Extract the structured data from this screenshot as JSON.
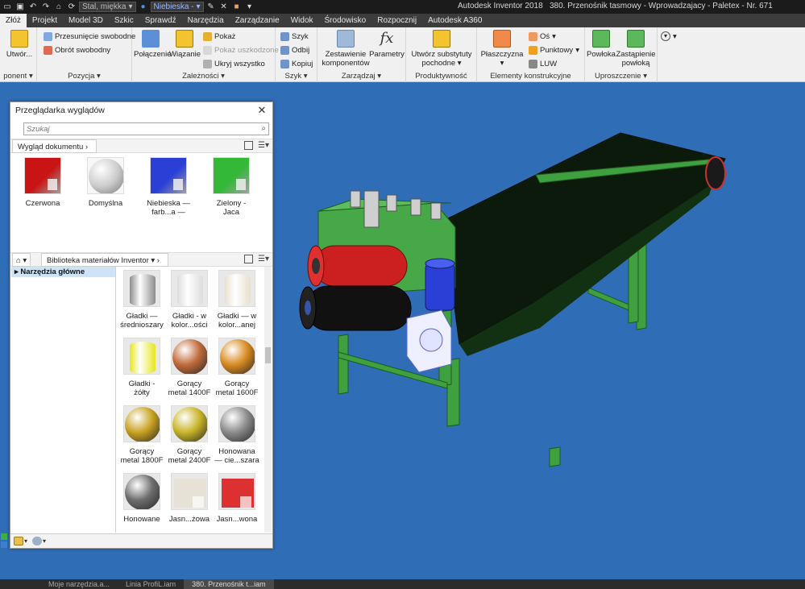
{
  "title_bar": {
    "material_dropdown": "Stal, miękka",
    "appearance_dropdown": "Niebieska -",
    "app_name": "Autodesk Inventor 2018",
    "document_title": "380. Przenośnik tasmowy - Wprowadzajacy - Paletex - Nr. 671"
  },
  "tabs": [
    "Złóż",
    "Projekt",
    "Model 3D",
    "Szkic",
    "Sprawdź",
    "Narzędzia",
    "Zarządzanie",
    "Widok",
    "Środowisko",
    "Rozpocznij",
    "Autodesk A360"
  ],
  "ribbon": {
    "panels": {
      "component": "ponent",
      "position": "Pozycja",
      "relations": "Zależności",
      "pattern": "Szyk",
      "manage": "Zarządzaj",
      "productivity": "Produktywność",
      "work_features": "Elementy konstrukcyjne",
      "simplification": "Uproszczenie"
    },
    "buttons": {
      "create": "Utwór...",
      "free_move": "Przesunięcie swobodne",
      "free_rotate": "Obrót swobodny",
      "joint": "Połączenie",
      "constrain": "Wiązanie",
      "show": "Pokaż",
      "show_sick": "Pokaż uszkodzone",
      "hide_all": "Ukryj wszystko",
      "pattern": "Szyk",
      "mirror": "Odbij",
      "copy": "Kopiuj",
      "bom_line1": "Zestawienie",
      "bom_line2": "komponentów",
      "parameters": "Parametry",
      "substitute_line1": "Utwórz substytuty",
      "substitute_line2": "pochodne",
      "plane": "Płaszczyzna",
      "axis": "Oś",
      "point": "Punktowy",
      "ucs": "LUW",
      "shrinkwrap": "Powłoka",
      "shrinkwrap_sub_line1": "Zastąpienie",
      "shrinkwrap_sub_line2": "powłoką"
    }
  },
  "appearance_browser": {
    "title": "Przeglądarka wyglądów",
    "search_placeholder": "Szukaj",
    "doc_section": "Wygląd dokumentu",
    "doc_appearances": [
      {
        "label1": "Czerwona",
        "label2": "",
        "color": "#c81414"
      },
      {
        "label1": "Domyślna",
        "label2": "",
        "color": "#d8d8d8"
      },
      {
        "label1": "Niebieska —",
        "label2": "farb...a —",
        "color": "#2a3fd6"
      },
      {
        "label1": "Zielony -",
        "label2": "Jaca",
        "color": "#33b838"
      }
    ],
    "library": "Biblioteka materiałów Inventor",
    "tree_item": "Narzędzia główne",
    "materials": [
      {
        "label1": "Gładki —",
        "label2": "średnioszary",
        "color": "#8c8c8c",
        "shape": "cyl"
      },
      {
        "label1": "Gładki - w",
        "label2": "kolor...ości",
        "color": "#dcdcdc",
        "shape": "cyl"
      },
      {
        "label1": "Gładki — w",
        "label2": "kolor...anej",
        "color": "#e8e0cc",
        "shape": "cyl"
      },
      {
        "label1": "Gładki -",
        "label2": "żółty",
        "color": "#e6e61c",
        "shape": "cyl"
      },
      {
        "label1": "Gorący",
        "label2": "metal 1400F",
        "color": "#c06a3a",
        "shape": "sphere"
      },
      {
        "label1": "Gorący",
        "label2": "metal 1600F",
        "color": "#d98a22",
        "shape": "sphere"
      },
      {
        "label1": "Gorący",
        "label2": "metal 1800F",
        "color": "#c9a222",
        "shape": "sphere"
      },
      {
        "label1": "Gorący",
        "label2": "metal 2400F",
        "color": "#c8b428",
        "shape": "sphere"
      },
      {
        "label1": "Honowana",
        "label2": "— cie...szara",
        "color": "#8a8a8a",
        "shape": "sphere"
      },
      {
        "label1": "Honowane",
        "label2": "",
        "color": "#6e6e6e",
        "shape": "sphere"
      },
      {
        "label1": "Jasn...żowa",
        "label2": "",
        "color": "#e6e2d6",
        "shape": "box"
      },
      {
        "label1": "Jasn...wona",
        "label2": "",
        "color": "#dd3030",
        "shape": "box"
      }
    ]
  },
  "bottom_tabs": [
    "Moje narzędzia.a...",
    "Linia ProfiL.iam",
    "380. Przenośnik t...iam"
  ]
}
